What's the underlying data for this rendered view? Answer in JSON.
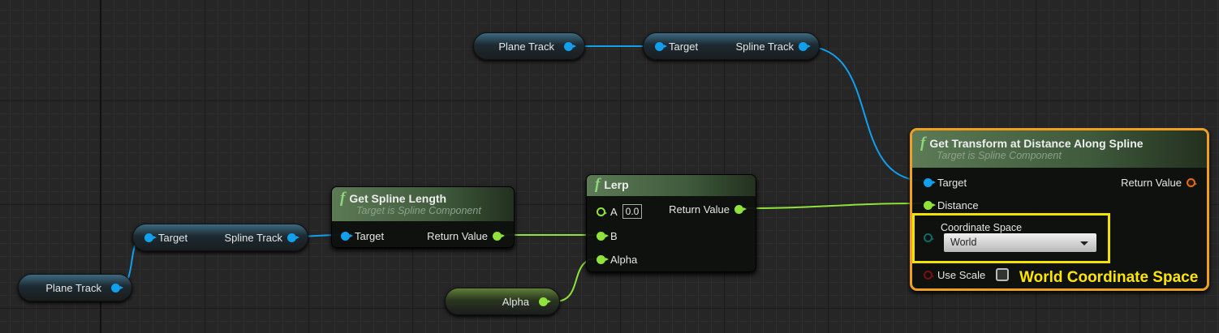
{
  "variables": {
    "plane_track_top": "Plane Track",
    "plane_track_bottom": "Plane Track",
    "alpha": "Alpha"
  },
  "getter_top": {
    "target": "Target",
    "output": "Spline Track"
  },
  "getter_bottom": {
    "target": "Target",
    "output": "Spline Track"
  },
  "get_spline_length": {
    "title": "Get Spline Length",
    "subtitle": "Target is Spline Component",
    "target": "Target",
    "return": "Return Value"
  },
  "lerp": {
    "title": "Lerp",
    "a": "A",
    "a_value": "0.0",
    "b": "B",
    "alpha": "Alpha",
    "return": "Return Value"
  },
  "get_transform": {
    "title": "Get Transform at Distance Along Spline",
    "subtitle": "Target is Spline Component",
    "target": "Target",
    "distance": "Distance",
    "coord_label": "Coordinate Space",
    "coord_value": "World",
    "use_scale": "Use Scale",
    "use_scale_checked": false,
    "return": "Return Value"
  },
  "annotation": "World Coordinate Space",
  "colors": {
    "object_pin": "#11a0ee",
    "float_pin": "#8fe33a",
    "transform_pin": "#e46c12",
    "highlight": "#f2e200",
    "selection": "#f0a020"
  }
}
